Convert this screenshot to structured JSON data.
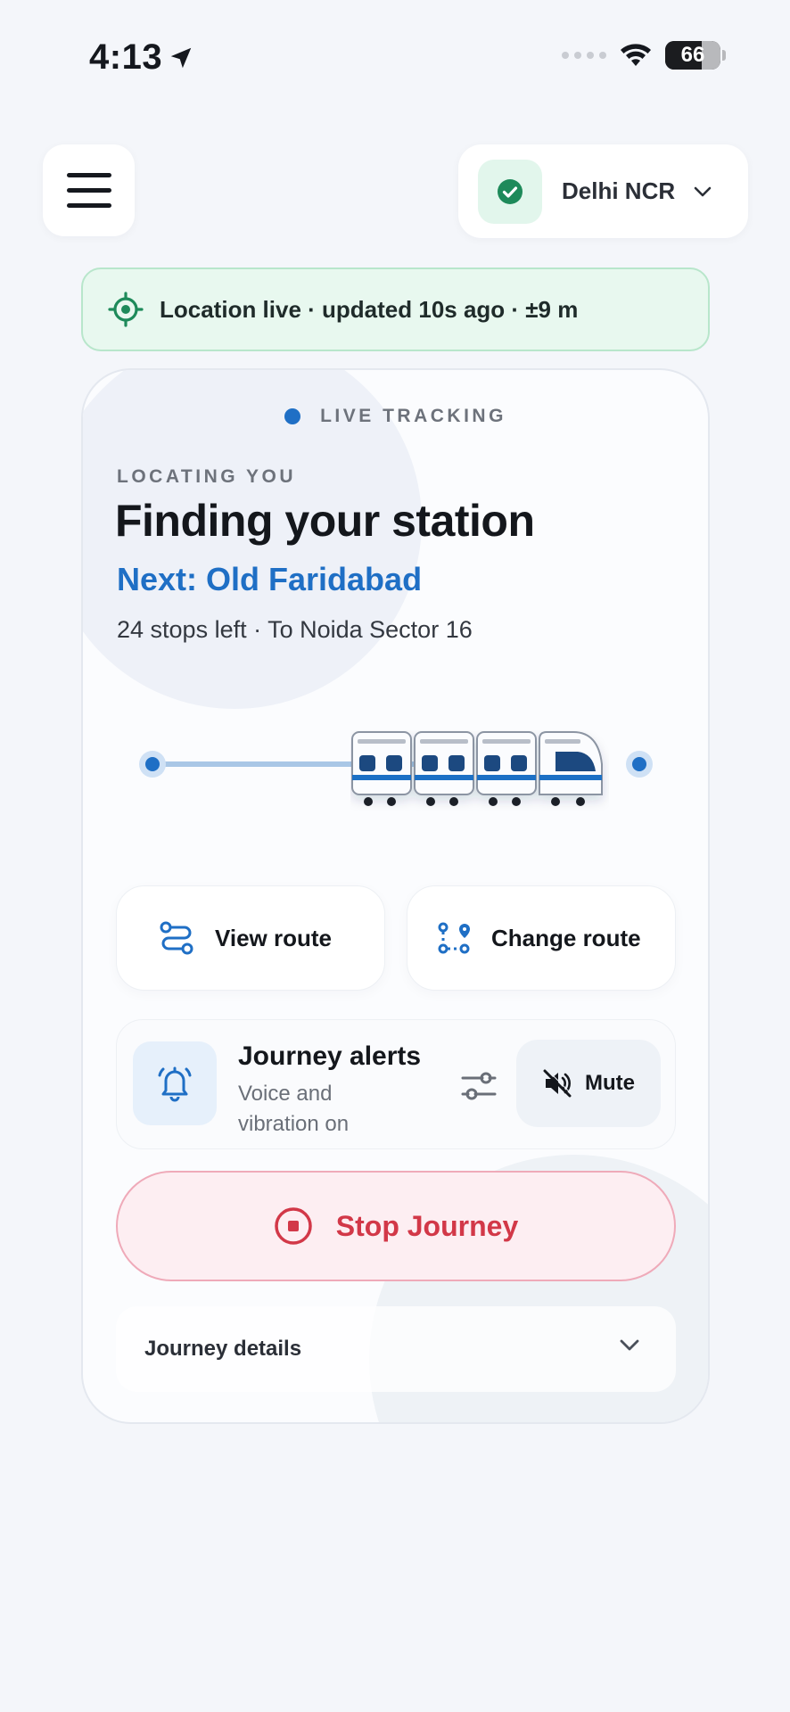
{
  "status_bar": {
    "time": "4:13",
    "battery": "66"
  },
  "header": {
    "region_label": "Delhi NCR"
  },
  "location_banner": {
    "text": "Location live · updated 10s ago · ±9 m"
  },
  "card": {
    "live_label": "LIVE TRACKING",
    "eyebrow": "LOCATING YOU",
    "headline": "Finding your station",
    "next_station": "Next: Old Faridabad",
    "stops_info": "24 stops left · To Noida Sector 16",
    "actions": {
      "view_route": "View route",
      "change_route": "Change route"
    },
    "alerts": {
      "title": "Journey alerts",
      "subtitle": "Voice and vibration on",
      "mute_label": "Mute"
    },
    "stop_label": "Stop Journey",
    "details_label": "Journey details"
  },
  "colors": {
    "accent": "#1f6fc5",
    "success": "#1e8a5a",
    "danger": "#d23848",
    "text": "#15181e"
  },
  "icons": [
    "location-arrow-icon",
    "wifi-icon",
    "battery-icon",
    "hamburger-menu-icon",
    "check-circle-icon",
    "chevron-down-icon",
    "location-target-icon",
    "train-icon",
    "route-icon",
    "change-route-icon",
    "bell-icon",
    "sliders-icon",
    "speaker-mute-icon",
    "stop-icon"
  ]
}
